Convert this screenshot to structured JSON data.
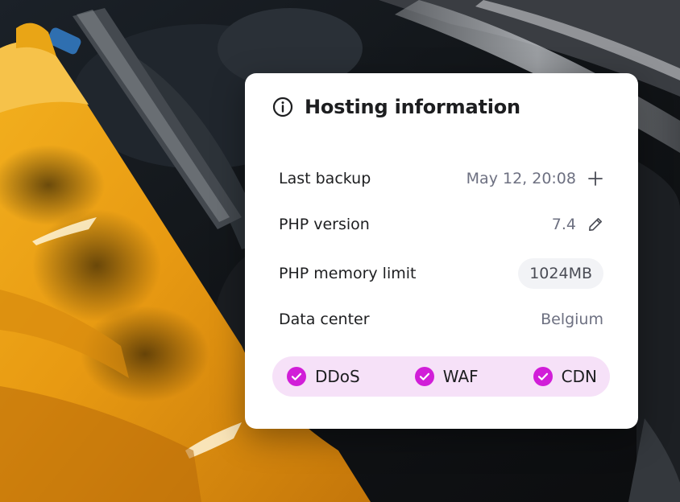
{
  "card": {
    "title": "Hosting information",
    "info_icon": "info-icon"
  },
  "rows": [
    {
      "label": "Last backup",
      "value": "May 12, 20:08",
      "action_icon": "plus-icon"
    },
    {
      "label": "PHP version",
      "value": "7.4",
      "action_icon": "pencil-icon"
    },
    {
      "label": "PHP memory limit",
      "value": "1024MB"
    },
    {
      "label": "Data center",
      "value": "Belgium"
    }
  ],
  "features": [
    {
      "label": "DDoS",
      "icon": "check-circle-icon"
    },
    {
      "label": "WAF",
      "icon": "check-circle-icon"
    },
    {
      "label": "CDN",
      "icon": "check-circle-icon"
    }
  ],
  "colors": {
    "accent": "#d11ed8",
    "feature_bg": "#f6e1f8",
    "text_primary": "#1d1e20",
    "text_secondary": "#6d7081",
    "pill_bg": "#f2f3f6",
    "photo_yellow": "#f0a81e"
  }
}
